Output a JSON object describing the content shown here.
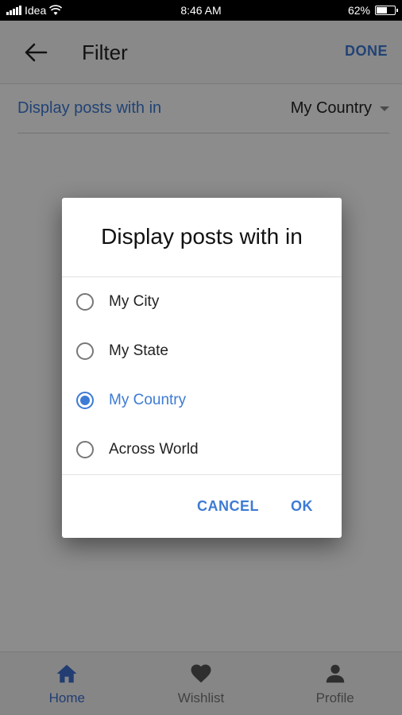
{
  "status_bar": {
    "carrier": "Idea",
    "time": "8:46 AM",
    "battery": "62%",
    "battery_level": 0.62
  },
  "app_bar": {
    "title": "Filter",
    "done_label": "DONE"
  },
  "filter": {
    "label": "Display posts with in",
    "selected_value": "My Country"
  },
  "dialog": {
    "title": "Display posts with in",
    "options": [
      {
        "label": "My City",
        "checked": false
      },
      {
        "label": "My State",
        "checked": false
      },
      {
        "label": "My Country",
        "checked": true
      },
      {
        "label": "Across World",
        "checked": false
      }
    ],
    "cancel_label": "CANCEL",
    "ok_label": "OK"
  },
  "bottom_nav": {
    "items": [
      {
        "label": "Home",
        "icon": "home-icon",
        "active": true
      },
      {
        "label": "Wishlist",
        "icon": "heart-icon",
        "active": false
      },
      {
        "label": "Profile",
        "icon": "person-icon",
        "active": false
      }
    ]
  },
  "colors": {
    "accent": "#3d7bd5",
    "status_bar": "#000000",
    "scrim": "rgba(0,0,0,0.45)"
  }
}
